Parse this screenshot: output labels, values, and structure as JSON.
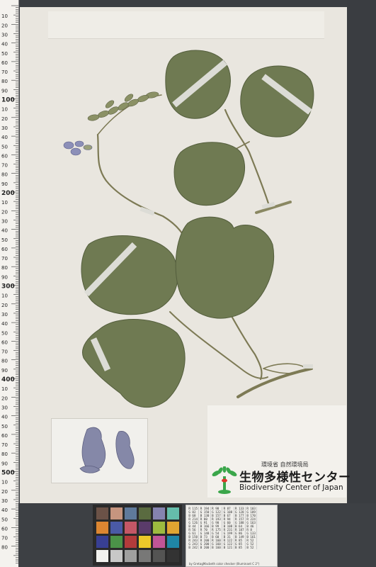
{
  "ruler": {
    "labels": [
      "10",
      "20",
      "30",
      "40",
      "50",
      "60",
      "70",
      "80",
      "90",
      "100",
      "10",
      "20",
      "30",
      "40",
      "50",
      "60",
      "70",
      "80",
      "90",
      "200",
      "10",
      "20",
      "30",
      "40",
      "50",
      "60",
      "70",
      "80",
      "90",
      "300",
      "10",
      "20",
      "30",
      "40",
      "50",
      "60",
      "70",
      "80",
      "90",
      "400",
      "10",
      "20",
      "30",
      "40",
      "50",
      "60",
      "70",
      "80",
      "90",
      "500",
      "10",
      "20",
      "30",
      "40",
      "50",
      "60",
      "70",
      "80"
    ]
  },
  "logo": {
    "ministry": "環境省 自然環境局",
    "title_jp": "生物多様性センター",
    "title_en": "Biodiversity Center of Japan"
  },
  "colors": {
    "leaf": "#6f7a52",
    "leaf_dark": "#535d3c",
    "stem": "#7d7a55",
    "tape": "#dcdcd6",
    "flower": "#8c8fb8",
    "brand_green": "#3aa64a"
  },
  "color_checker": {
    "patches": [
      "#6b5247",
      "#c6957f",
      "#5f7a9b",
      "#5a6b40",
      "#8583b0",
      "#65bdab",
      "#dc8631",
      "#4a5aa6",
      "#c45766",
      "#5a3b6a",
      "#9dbb3f",
      "#e0a531",
      "#383f93",
      "#4b9348",
      "#b23b3b",
      "#ecc82a",
      "#c05597",
      "#1f86a6",
      "#f2f2ef",
      "#c8c8c7",
      "#a0a09f",
      "#787877",
      "#545453",
      "#333333"
    ]
  },
  "values_card": {
    "rows": [
      [
        "R 115",
        "R 194",
        "R 98",
        "R 87",
        "R 133",
        "R 103"
      ],
      [
        "G 82",
        "G 150",
        "G 122",
        "G 108",
        "G 128",
        "G 189"
      ],
      [
        "B 68",
        "B 130",
        "B 157",
        "B 67",
        "B 177",
        "B 170"
      ],
      [
        "R 214",
        "R 80",
        "R 193",
        "R 94",
        "R 157",
        "R 224"
      ],
      [
        "G 126",
        "G 91",
        "G 90",
        "G 60",
        "G 188",
        "G 163"
      ],
      [
        "B 44",
        "B 166",
        "B 99",
        "B 108",
        "B 64",
        "B 46"
      ],
      [
        "R 56",
        "R 70",
        "R 175",
        "R 231",
        "R 187",
        "R 8"
      ],
      [
        "G 61",
        "G 148",
        "G 54",
        "G 199",
        "G 86",
        "G 133"
      ],
      [
        "B 150",
        "B 73",
        "B 60",
        "B 31",
        "B 149",
        "B 161"
      ],
      [
        "R 243",
        "R 200",
        "R 160",
        "R 122",
        "R 85",
        "R 52"
      ],
      [
        "G 243",
        "G 200",
        "G 160",
        "G 122",
        "G 85",
        "G 52"
      ],
      [
        "B 242",
        "B 200",
        "B 160",
        "B 121",
        "B 85",
        "B 52"
      ]
    ],
    "caption": "by GretagMacbeth color checker (Illuminant C 2°)"
  }
}
